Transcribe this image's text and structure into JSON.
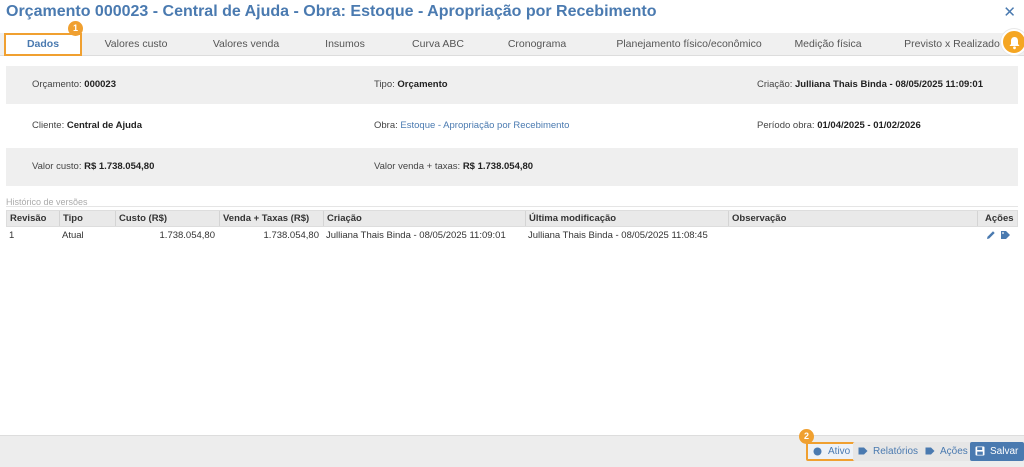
{
  "window": {
    "title": "Orçamento 000023 - Central de Ajuda - Obra: Estoque - Apropriação por Recebimento",
    "close_label": "✕"
  },
  "tabs": [
    {
      "label": "Dados",
      "active": true,
      "badge": "1"
    },
    {
      "label": "Valores custo"
    },
    {
      "label": "Valores venda"
    },
    {
      "label": "Insumos"
    },
    {
      "label": "Curva ABC"
    },
    {
      "label": "Cronograma"
    },
    {
      "label": "Planejamento físico/econômico"
    },
    {
      "label": "Medição física"
    },
    {
      "label": "Previsto x Realizado"
    }
  ],
  "info": {
    "orcamento": {
      "label": "Orçamento:",
      "value": "000023"
    },
    "tipo": {
      "label": "Tipo:",
      "value": "Orçamento"
    },
    "criacao": {
      "label": "Criação:",
      "value": "Julliana Thais Binda - 08/05/2025 11:09:01"
    },
    "cliente": {
      "label": "Cliente:",
      "value": "Central de Ajuda"
    },
    "obra": {
      "label": "Obra:",
      "value": "Estoque - Apropriação por Recebimento"
    },
    "periodo": {
      "label": "Período obra:",
      "value": "01/04/2025 - 01/02/2026"
    },
    "valor_custo": {
      "label": "Valor custo:",
      "value": "R$ 1.738.054,80"
    },
    "valor_venda": {
      "label": "Valor venda + taxas:",
      "value": "R$ 1.738.054,80"
    }
  },
  "history": {
    "section_title": "Histórico de versões",
    "columns": [
      "Revisão",
      "Tipo",
      "Custo (R$)",
      "Venda + Taxas (R$)",
      "Criação",
      "Última modificação",
      "Observação",
      "Ações"
    ],
    "rows": [
      {
        "revisao": "1",
        "tipo": "Atual",
        "custo": "1.738.054,80",
        "venda": "1.738.054,80",
        "criacao": "Julliana Thais Binda - 08/05/2025 11:09:01",
        "ultima": "Julliana Thais Binda - 08/05/2025 11:08:45",
        "observacao": ""
      }
    ]
  },
  "footer": {
    "status_label": "Ativo",
    "status_badge": "2",
    "relatorios_label": "Relatórios",
    "acoes_label": "Ações",
    "salvar_label": "Salvar"
  },
  "colors": {
    "accent": "#4a7ab0",
    "highlight": "#f0a030",
    "bell": "#f5a623"
  }
}
